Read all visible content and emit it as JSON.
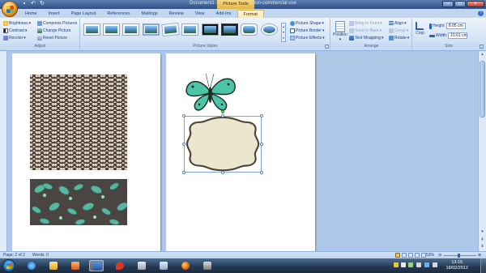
{
  "window": {
    "title": "Document1 - Microsoft Word non-commercial use",
    "contextual_tab": "Picture Tools"
  },
  "tabs": [
    {
      "label": "Home"
    },
    {
      "label": "Insert"
    },
    {
      "label": "Page Layout"
    },
    {
      "label": "References"
    },
    {
      "label": "Mailings"
    },
    {
      "label": "Review"
    },
    {
      "label": "View"
    },
    {
      "label": "Add-Ins"
    },
    {
      "label": "Format"
    }
  ],
  "ribbon": {
    "adjust": {
      "label": "Adjust",
      "brightness": "Brightness",
      "contrast": "Contrast",
      "recolor": "Recolor",
      "compress": "Compress Pictures",
      "change": "Change Picture",
      "reset": "Reset Picture"
    },
    "styles": {
      "label": "Picture Styles",
      "shape": "Picture Shape",
      "border": "Picture Border",
      "effects": "Picture Effects"
    },
    "arrange": {
      "label": "Arrange",
      "position": "Position",
      "bring_front": "Bring to Front",
      "send_back": "Send to Back",
      "text_wrapping": "Text Wrapping",
      "align": "Align",
      "group": "Group",
      "rotate": "Rotate"
    },
    "size": {
      "label": "Size",
      "crop": "Crop",
      "height_label": "Height:",
      "height_value": "8.05 cm",
      "width_label": "Width:",
      "width_value": "10.61 cm"
    }
  },
  "status": {
    "page": "Page: 2 of 2",
    "words": "Words: 0",
    "zoom": "53%"
  },
  "taskbar": {
    "time": "13:15",
    "date": "18/02/2012"
  },
  "colors": {
    "ribbon_accent": "#15428b",
    "format_tab": "#ffe9a8",
    "document_bg": "#aec9e8"
  }
}
